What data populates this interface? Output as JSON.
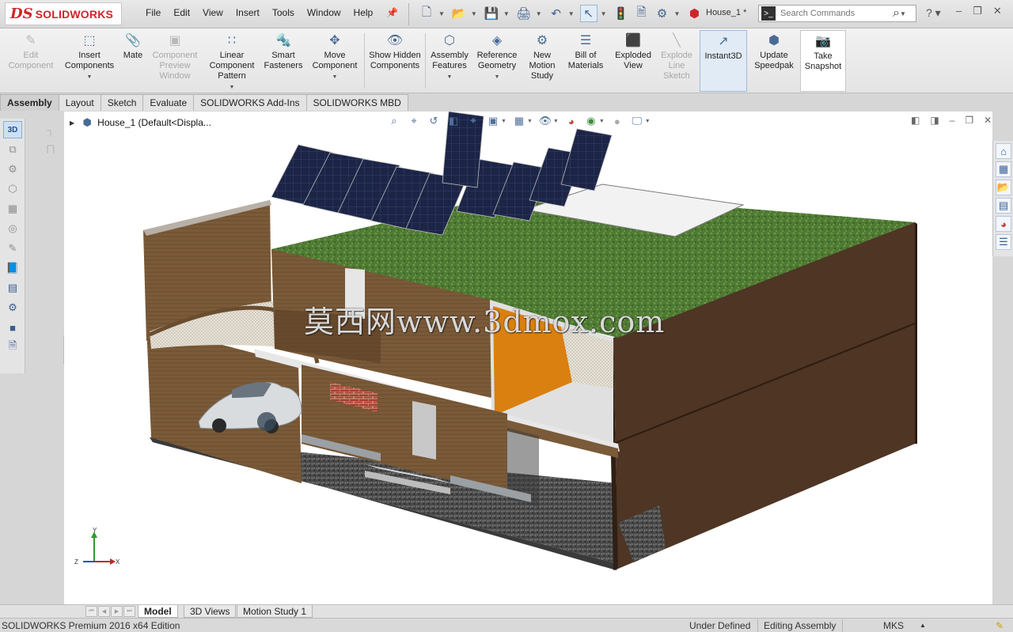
{
  "app": {
    "logo_mark": "DS",
    "logo_text": "SOLIDWORKS",
    "document_title": "House_1 *"
  },
  "menu": [
    "File",
    "Edit",
    "View",
    "Insert",
    "Tools",
    "Window",
    "Help"
  ],
  "search": {
    "placeholder": "Search Commands"
  },
  "commands": [
    {
      "label": "Edit Component",
      "icon": "edit-component-icon",
      "disabled": true
    },
    {
      "label": "Insert Components",
      "icon": "insert-components-icon",
      "disabled": false,
      "dropdown": true
    },
    {
      "label": "Mate",
      "icon": "mate-icon",
      "disabled": false
    },
    {
      "label": "Component Preview Window",
      "icon": "component-preview-icon",
      "disabled": true
    },
    {
      "label": "Linear Component Pattern",
      "icon": "linear-pattern-icon",
      "disabled": false,
      "dropdown": true
    },
    {
      "label": "Smart Fasteners",
      "icon": "smart-fasteners-icon",
      "disabled": false
    },
    {
      "label": "Move Component",
      "icon": "move-component-icon",
      "disabled": false,
      "dropdown": true
    },
    {
      "label": "Show Hidden Components",
      "icon": "show-hidden-icon",
      "disabled": false
    },
    {
      "label": "Assembly Features",
      "icon": "assembly-features-icon",
      "disabled": false,
      "dropdown": true
    },
    {
      "label": "Reference Geometry",
      "icon": "reference-geometry-icon",
      "disabled": false,
      "dropdown": true
    },
    {
      "label": "New Motion Study",
      "icon": "motion-study-icon",
      "disabled": false
    },
    {
      "label": "Bill of Materials",
      "icon": "bill-of-materials-icon",
      "disabled": false
    },
    {
      "label": "Exploded View",
      "icon": "exploded-view-icon",
      "disabled": false
    },
    {
      "label": "Explode Line Sketch",
      "icon": "explode-line-icon",
      "disabled": true
    },
    {
      "label": "Instant3D",
      "icon": "instant3d-icon",
      "disabled": false,
      "active": true
    },
    {
      "label": "Update Speedpak",
      "icon": "speedpak-icon",
      "disabled": false
    },
    {
      "label": "Take Snapshot",
      "icon": "camera-icon",
      "disabled": false
    }
  ],
  "tabs": [
    "Assembly",
    "Layout",
    "Sketch",
    "Evaluate",
    "SOLIDWORKS Add-Ins",
    "SOLIDWORKS MBD"
  ],
  "tree": {
    "root": "House_1  (Default<Displa..."
  },
  "watermark": "莫西网www.3dmox.com",
  "triad": {
    "y": "Y",
    "z": "Z",
    "x": "X"
  },
  "bottom_tabs": [
    "Model",
    "3D Views",
    "Motion Study 1"
  ],
  "status": {
    "edition": "SOLIDWORKS Premium 2016 x64 Edition",
    "definition": "Under Defined",
    "mode": "Editing Assembly",
    "units": "MKS"
  }
}
